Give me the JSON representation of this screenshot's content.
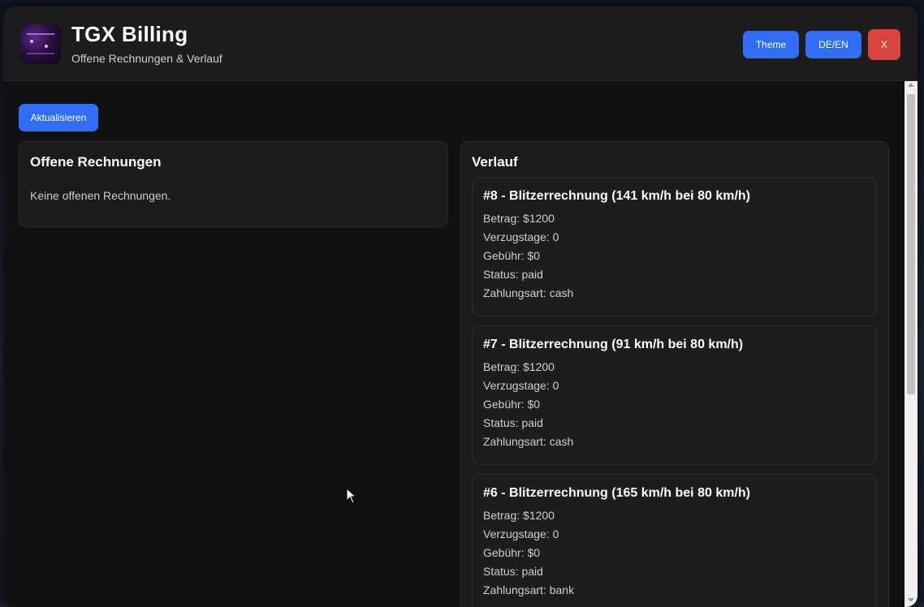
{
  "header": {
    "title": "TGX Billing",
    "subtitle": "Offene Rechnungen & Verlauf",
    "theme_label": "Theme",
    "lang_label": "DE/EN",
    "close_label": "X"
  },
  "toolbar": {
    "refresh_label": "Aktualisieren"
  },
  "open_invoices": {
    "title": "Offene Rechnungen",
    "empty_text": "Keine offenen Rechnungen."
  },
  "history": {
    "title": "Verlauf",
    "items": [
      {
        "title": "#8 - Blitzerrechnung (141 km/h bei 80 km/h)",
        "amount": "Betrag: $1200",
        "delay": "Verzugstage: 0",
        "fee": "Gebühr: $0",
        "status": "Status: paid",
        "payment": "Zahlungsart: cash"
      },
      {
        "title": "#7 - Blitzerrechnung (91 km/h bei 80 km/h)",
        "amount": "Betrag: $1200",
        "delay": "Verzugstage: 0",
        "fee": "Gebühr: $0",
        "status": "Status: paid",
        "payment": "Zahlungsart: cash"
      },
      {
        "title": "#6 - Blitzerrechnung (165 km/h bei 80 km/h)",
        "amount": "Betrag: $1200",
        "delay": "Verzugstage: 0",
        "fee": "Gebühr: $0",
        "status": "Status: paid",
        "payment": "Zahlungsart: bank"
      }
    ]
  },
  "colors": {
    "accent": "#2f6ef5",
    "danger": "#d9443f",
    "background": "#111111",
    "panel": "#1b1b1b"
  },
  "icons": {
    "cursor": "cursor-arrow-icon"
  }
}
